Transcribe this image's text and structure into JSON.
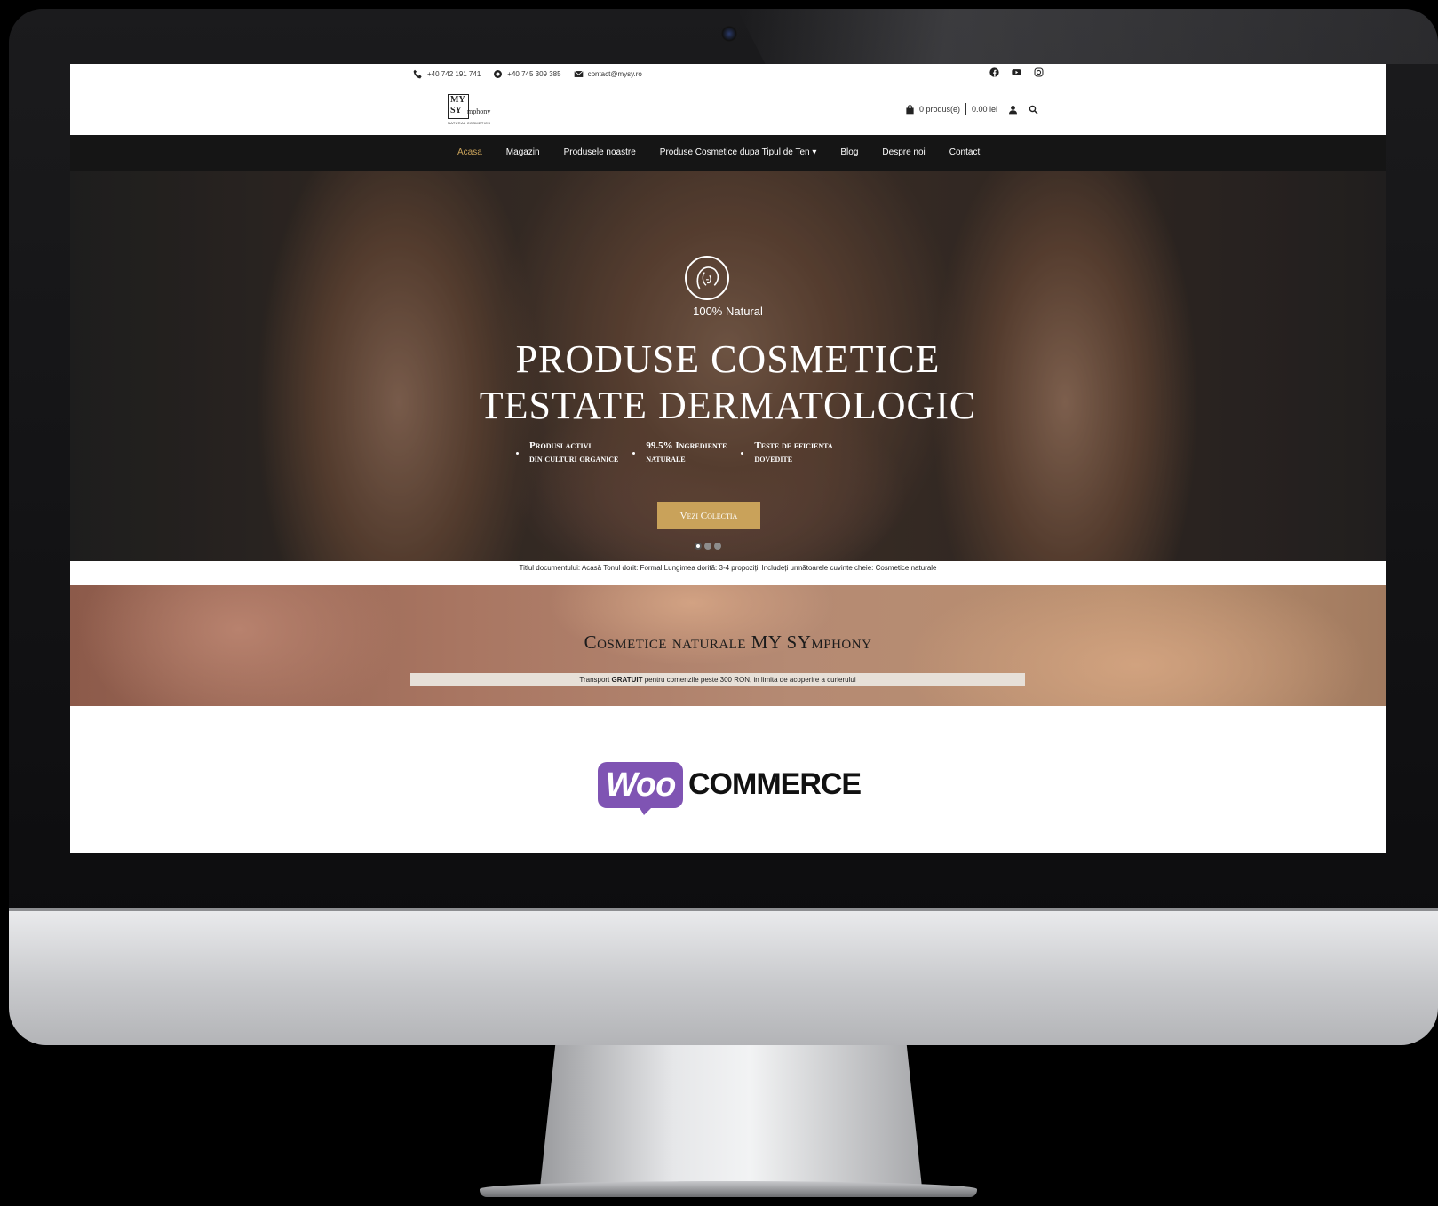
{
  "topbar": {
    "phone1": "+40 742 191 741",
    "phone2": "+40 745 309 385",
    "email": "contact@mysy.ro",
    "social_icons": [
      "facebook-icon",
      "youtube-icon",
      "instagram-icon"
    ]
  },
  "header": {
    "logo_line1": "MY",
    "logo_line2": "SY",
    "logo_rest": "mphony",
    "logo_sub": "NATURAL COSMETICS",
    "cart_count": "0 produs(e)",
    "cart_total": "0.00 lei"
  },
  "nav": {
    "items": [
      "Acasa",
      "Magazin",
      "Produsele noastre",
      "Produse Cosmetice dupa Tipul de Ten ▾",
      "Blog",
      "Despre noi",
      "Contact"
    ]
  },
  "hero": {
    "tag": "100% Natural",
    "title_line1": "PRODUSE COSMETICE",
    "title_line2": "TESTATE DERMATOLOGIC",
    "features": [
      {
        "line1": "Produsi activi",
        "line2": "din culturi organice"
      },
      {
        "line1": "99.5% Ingrediente",
        "line2": "naturale"
      },
      {
        "line1": "Teste de eficienta",
        "line2": "dovedite"
      }
    ],
    "button": "Vezi Colectia",
    "slide_count": 3,
    "active_slide": 1
  },
  "doc_note": "Titlul documentului: Acasă Tonul dorit: Formal Lungimea dorită: 3-4 propoziții Includeți următoarele cuvinte cheie: Cosmetice naturale",
  "promo": {
    "title": "Cosmetice naturale MY SYmphony",
    "shipping_pre": "Transport ",
    "shipping_bold": "GRATUIT",
    "shipping_post": " pentru comenzile peste 300 RON, in limita de acoperire a curierului"
  },
  "woocommerce": {
    "logo_woo": "Woo",
    "logo_commerce": "COMMERCE"
  },
  "colors": {
    "accent": "#c9a25a",
    "nav_bg": "#151515",
    "woo_purple": "#7f54b3"
  }
}
